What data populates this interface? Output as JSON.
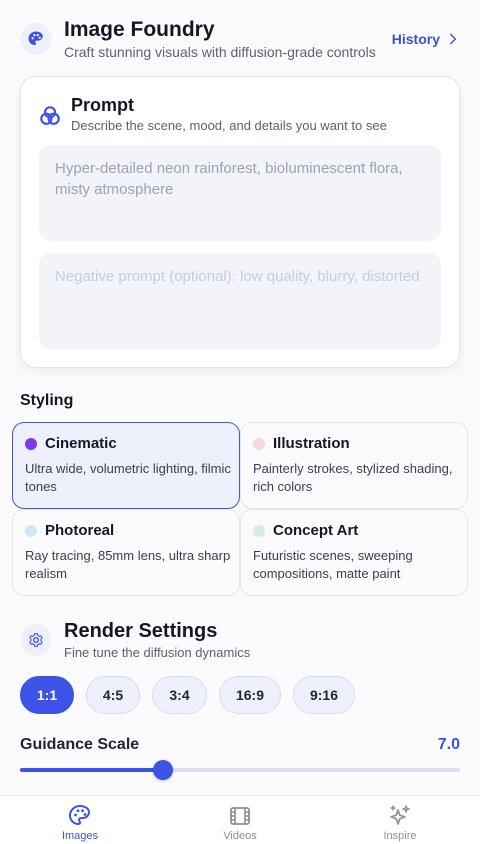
{
  "colors": {
    "accent": "#3d52e6",
    "cinematic_dot": "#7c3aed",
    "illustration_dot": "#f6d7dc",
    "photoreal_dot": "#cfe7f6",
    "concept_dot": "#d4efe2"
  },
  "header": {
    "title": "Image Foundry",
    "subtitle": "Craft stunning visuals with diffusion-grade controls",
    "icon": "palette-icon",
    "history_label": "History"
  },
  "prompt": {
    "title": "Prompt",
    "subtitle": "Describe the scene, mood, and details you want to see",
    "icon": "color-circles-icon",
    "positive_placeholder": "Hyper-detailed neon rainforest, bioluminescent flora, misty atmosphere",
    "positive_value": "",
    "negative_placeholder": "Negative prompt (optional): low quality, blurry, distorted",
    "negative_value": ""
  },
  "styling": {
    "label": "Styling",
    "styles": [
      {
        "name": "Cinematic",
        "desc": "Ultra wide, volumetric lighting, filmic tones",
        "selected": true
      },
      {
        "name": "Illustration",
        "desc": "Painterly strokes, stylized shading, rich colors",
        "selected": false
      },
      {
        "name": "Photoreal",
        "desc": "Ray tracing, 85mm lens, ultra sharp realism",
        "selected": false
      },
      {
        "name": "Concept Art",
        "desc": "Futuristic scenes, sweeping compositions, matte paint",
        "selected": false
      }
    ]
  },
  "render": {
    "title": "Render Settings",
    "subtitle": "Fine tune the diffusion dynamics",
    "icon": "gear-icon",
    "ratios": [
      "1:1",
      "4:5",
      "3:4",
      "16:9",
      "9:16"
    ],
    "selected_ratio": "1:1",
    "guidance_label": "Guidance Scale",
    "guidance_value": "7.0",
    "guidance_fraction": 0.325
  },
  "nav": {
    "items": [
      {
        "label": "Images",
        "icon": "palette-icon",
        "active": true
      },
      {
        "label": "Videos",
        "icon": "film-icon",
        "active": false
      },
      {
        "label": "Inspire",
        "icon": "sparkles-icon",
        "active": false
      }
    ]
  }
}
